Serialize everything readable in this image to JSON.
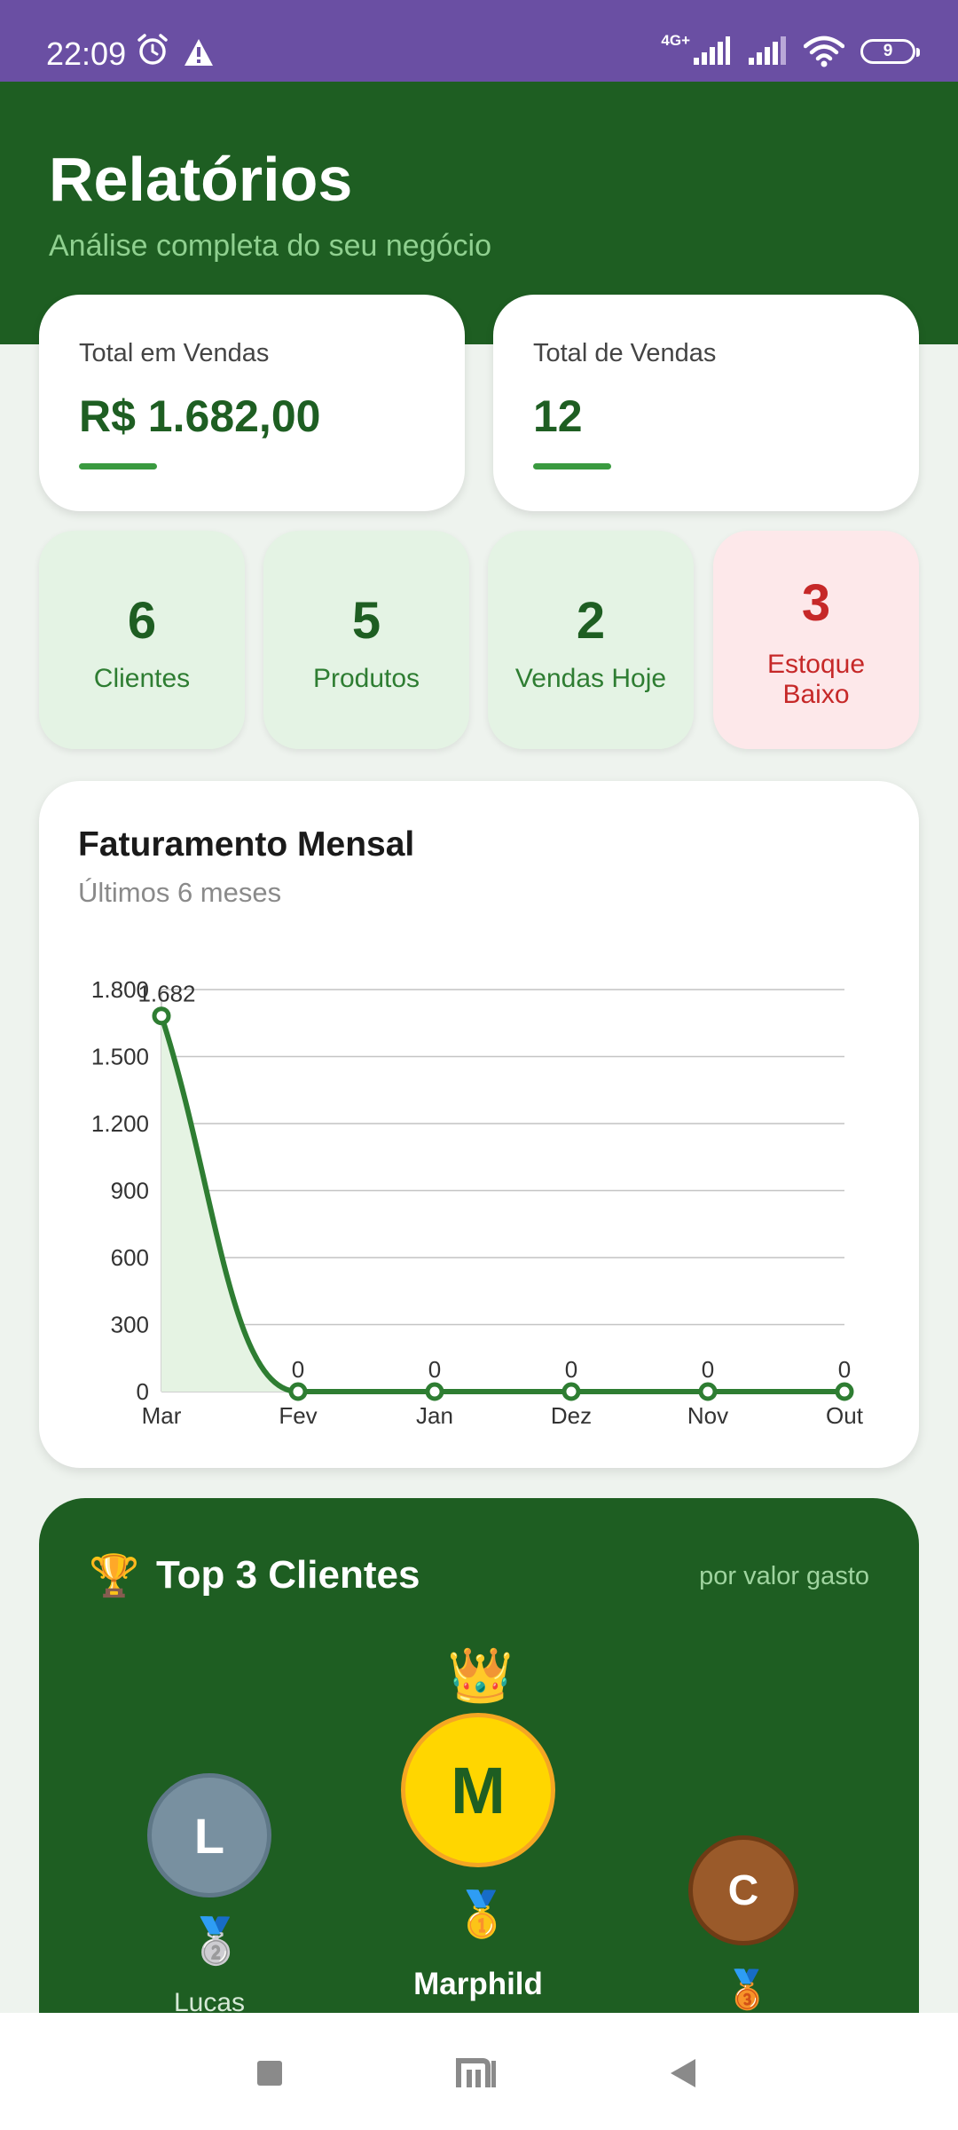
{
  "status_bar": {
    "time": "22:09",
    "network": "4G+",
    "battery": "9",
    "icons": [
      "alarm-icon",
      "warning-icon",
      "signal-icon",
      "signal-icon",
      "wifi-icon",
      "battery-icon"
    ]
  },
  "header": {
    "title": "Relatórios",
    "subtitle": "Análise completa do seu negócio"
  },
  "summary": [
    {
      "label": "Total em Vendas",
      "value": "R$ 1.682,00"
    },
    {
      "label": "Total de Vendas",
      "value": "12"
    }
  ],
  "stats": [
    {
      "value": "6",
      "label": "Clientes"
    },
    {
      "value": "5",
      "label": "Produtos"
    },
    {
      "value": "2",
      "label": "Vendas Hoje"
    },
    {
      "value": "3",
      "label": "Estoque Baixo"
    }
  ],
  "chart_section": {
    "title": "Faturamento Mensal",
    "subtitle": "Últimos 6 meses"
  },
  "chart_data": {
    "type": "area",
    "categories": [
      "Mar",
      "Fev",
      "Jan",
      "Dez",
      "Nov",
      "Out"
    ],
    "values": [
      1682,
      0,
      0,
      0,
      0,
      0
    ],
    "data_labels": [
      "1.682",
      "0",
      "0",
      "0",
      "0",
      "0"
    ],
    "yticks": [
      "0",
      "300",
      "600",
      "900",
      "1.200",
      "1.500",
      "1.800"
    ],
    "ylim": [
      0,
      1800
    ],
    "grid": true,
    "color": "#2e7d32"
  },
  "top_clients": {
    "title": "Top 3 Clientes",
    "hint": "por valor gasto",
    "trophy_icon": "trophy-icon",
    "clients": [
      {
        "initial": "M",
        "name": "Marphild",
        "rank": 1,
        "medal": "🥇"
      },
      {
        "initial": "L",
        "name": "Lucas",
        "rank": 2,
        "medal": "🥈"
      },
      {
        "initial": "C",
        "rank": 3,
        "medal": "🥉"
      }
    ],
    "crown": "👑",
    "trophy": "🏆"
  }
}
